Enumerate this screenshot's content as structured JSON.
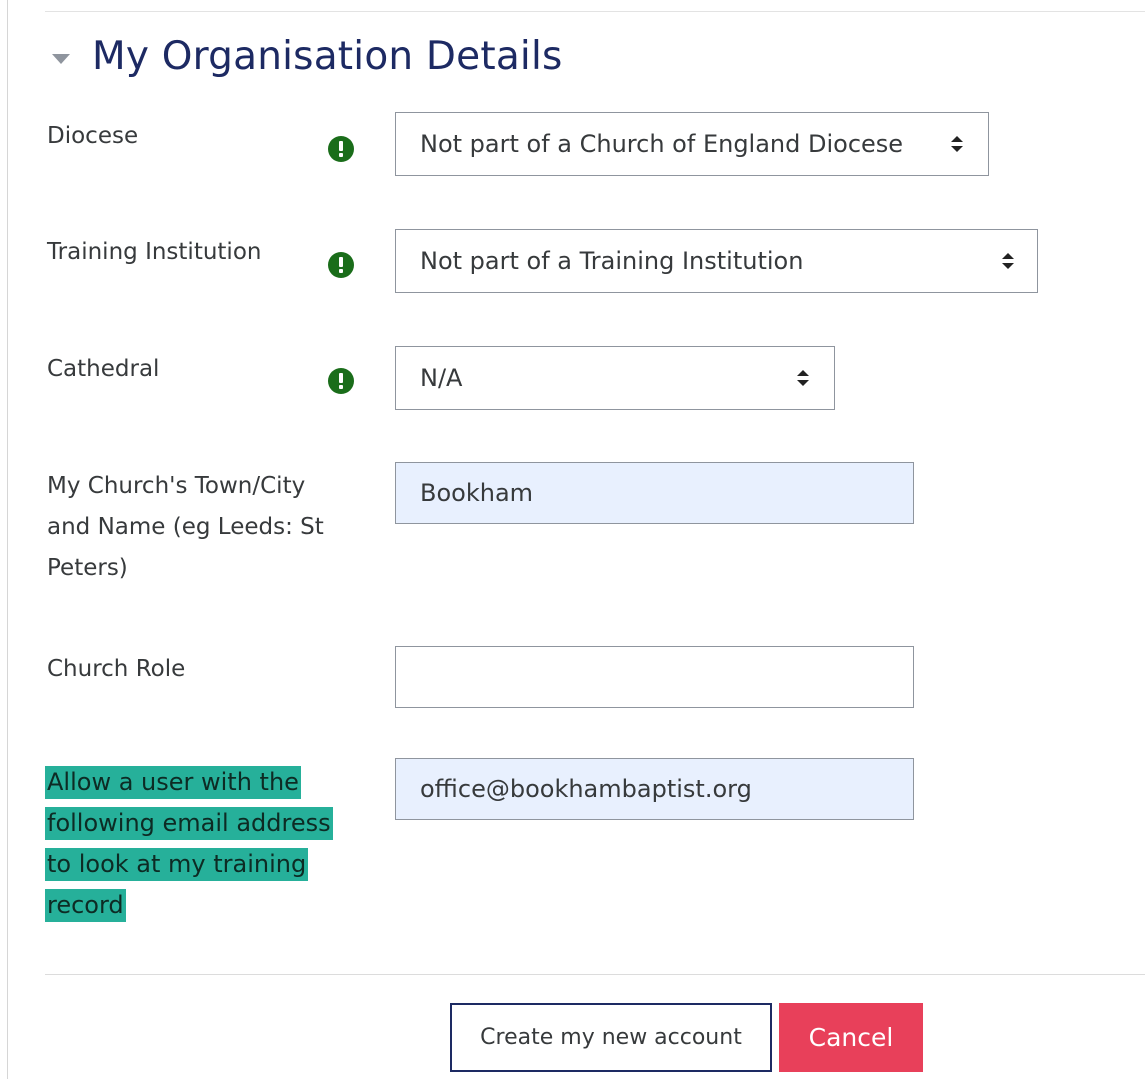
{
  "section": {
    "title": "My Organisation Details"
  },
  "fields": {
    "diocese": {
      "label": "Diocese",
      "value": "Not part of a Church of England Diocese"
    },
    "training_institution": {
      "label": "Training Institution",
      "value": "Not part of a Training Institution"
    },
    "cathedral": {
      "label": "Cathedral",
      "value": "N/A"
    },
    "church_town": {
      "label_lines": [
        "My Church's Town/City",
        "and Name (eg Leeds: St",
        "Peters)"
      ],
      "value": "Bookham"
    },
    "church_role": {
      "label": "Church Role",
      "value": ""
    },
    "allow_email": {
      "label_lines": [
        "Allow a user with the",
        "following email address",
        "to look at my training",
        "record"
      ],
      "value": "office@bookhambaptist.org"
    }
  },
  "buttons": {
    "create": "Create my new account",
    "cancel": "Cancel"
  },
  "colors": {
    "heading": "#1d2a63",
    "required_icon": "#1a6d1a",
    "highlight": "#26b09a",
    "cancel_button": "#e8405a",
    "autofill_bg": "#e8f0fe"
  }
}
